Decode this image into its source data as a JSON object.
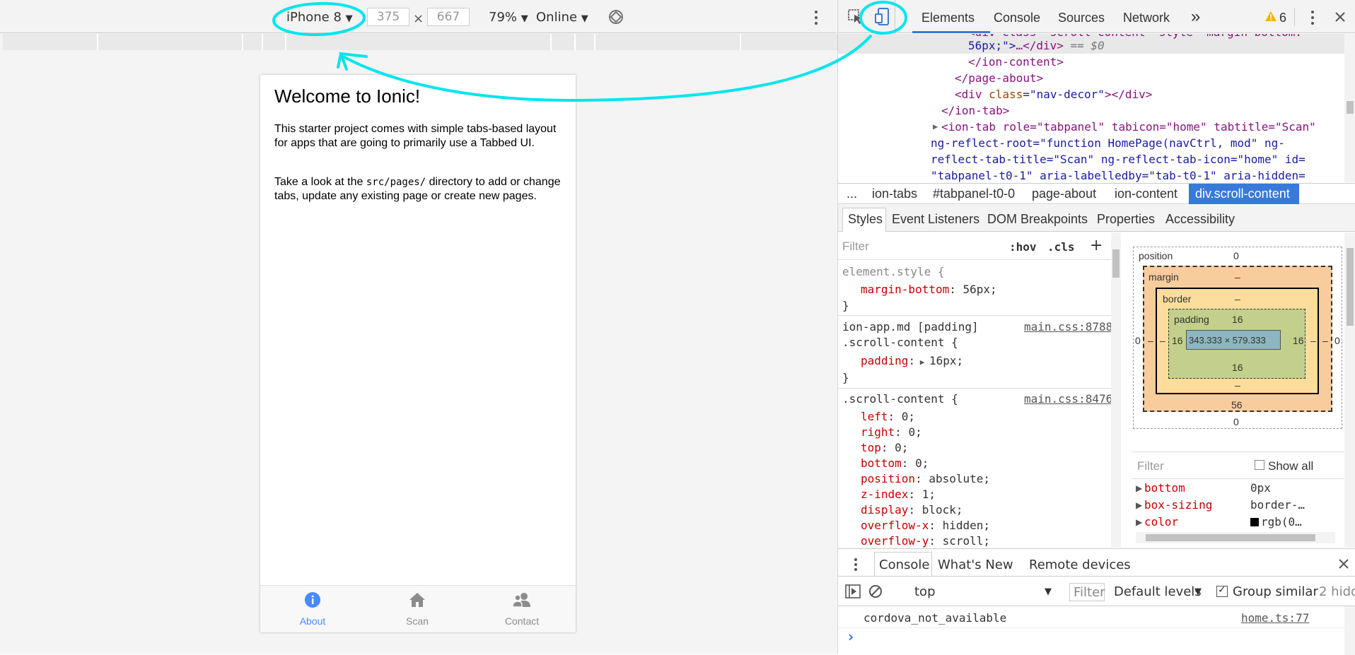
{
  "device_toolbar": {
    "device": "iPhone 8",
    "width": "375",
    "times": "×",
    "height": "667",
    "zoom": "79%",
    "network": "Online"
  },
  "phone": {
    "title": "Welcome to Ionic!",
    "para1": "This starter project comes with simple tabs-based layout for apps that are going to primarily use a Tabbed UI.",
    "para2_pre": "Take a look at the ",
    "para2_code": "src/pages/",
    "para2_post": " directory to add or change tabs, update any existing page or create new pages.",
    "tabs": [
      {
        "label": "About",
        "icon": "info-icon",
        "active": true
      },
      {
        "label": "Scan",
        "icon": "home-icon",
        "active": false
      },
      {
        "label": "Contact",
        "icon": "contacts-icon",
        "active": false
      }
    ]
  },
  "devtools": {
    "tabs": [
      "Elements",
      "Console",
      "Sources",
      "Network"
    ],
    "more": "»",
    "warnings": "6",
    "dom": {
      "l0": "<div class=\"scroll-content\" style=\"margin-bottom:",
      "l1a": "56px;\">",
      "l1b": "…</div>",
      "l1c": " == $0",
      "l2": "</ion-content>",
      "l3": "</page-about>",
      "l4a": "<div ",
      "l4b": "class",
      "l4c": "=\"nav-decor\"",
      "l4d": "></div>",
      "l5": "</ion-tab>",
      "l6": "<ion-tab role=\"tabpanel\" tabicon=\"home\" tabtitle=\"Scan\"",
      "l7": "ng-reflect-root=\"function HomePage(navCtrl, mod\" ng-",
      "l8": "reflect-tab-title=\"Scan\" ng-reflect-tab-icon=\"home\" id=",
      "l9": "\"tabpanel-t0-1\" aria-labelledby=\"tab-t0-1\" aria-hidden="
    },
    "breadcrumbs": [
      "...",
      "ion-tabs",
      "#tabpanel-t0-0",
      "page-about",
      "ion-content",
      "div.scroll-content"
    ],
    "subtabs": [
      "Styles",
      "Event Listeners",
      "DOM Breakpoints",
      "Properties",
      "Accessibility"
    ],
    "styles": {
      "filter_placeholder": "Filter",
      "hov": ":hov",
      "cls": ".cls",
      "plus": "+",
      "r1_selector": "element.style {",
      "r1_prop": "margin-bottom",
      "r1_val": ": 56px;",
      "close": "}",
      "r2_selector1": "ion-app.md [padding]",
      "r2_link": "main.css:8788",
      "r2_selector2": ".scroll-content {",
      "r2_prop": "padding",
      "r2_val": "16px;",
      "r3_selector": ".scroll-content {",
      "r3_link": "main.css:8476",
      "r3_props": [
        {
          "p": "left",
          "v": ": 0;"
        },
        {
          "p": "right",
          "v": ": 0;"
        },
        {
          "p": "top",
          "v": ": 0;"
        },
        {
          "p": "bottom",
          "v": ": 0;"
        },
        {
          "p": "position",
          "v": ": absolute;"
        },
        {
          "p": "z-index",
          "v": ": 1;"
        },
        {
          "p": "display",
          "v": ": block;"
        },
        {
          "p": "overflow-x",
          "v": ": hidden;"
        },
        {
          "p": "overflow-y",
          "v": ": scroll;"
        }
      ]
    },
    "box_model": {
      "position": "position",
      "pos_top": "0",
      "pos_left": "0",
      "pos_right": "0",
      "pos_bottom": "0",
      "margin": "margin",
      "margin_top": "–",
      "margin_left": "–",
      "margin_right": "–",
      "margin_bottom": "56",
      "border": "border",
      "border_top": "–",
      "border_left": "–",
      "border_right": "–",
      "border_bottom": "–",
      "padding": "padding",
      "padding_top": "16",
      "padding_left": "16",
      "padding_right": "16",
      "padding_bottom": "16",
      "content": "343.333 × 579.333"
    },
    "computed": {
      "filter_placeholder": "Filter",
      "show_all": "Show all",
      "rows": [
        {
          "p": "bottom",
          "v": "0px"
        },
        {
          "p": "box-sizing",
          "v": "border-…"
        },
        {
          "p": "color",
          "v": "rgb(0…"
        }
      ]
    },
    "drawer": {
      "tabs": [
        "Console",
        "What's New",
        "Remote devices"
      ],
      "context": "top",
      "filter": "Filter",
      "levels": "Default levels",
      "group_similar": "Group similar",
      "hidden": "2 hidd",
      "log_msg": "cordova_not_available",
      "log_src": "home.ts:77",
      "prompt": "›"
    }
  },
  "colors": {
    "accent": "#488aff",
    "highlight": "#00e5ee",
    "selected": "#3879d9"
  }
}
